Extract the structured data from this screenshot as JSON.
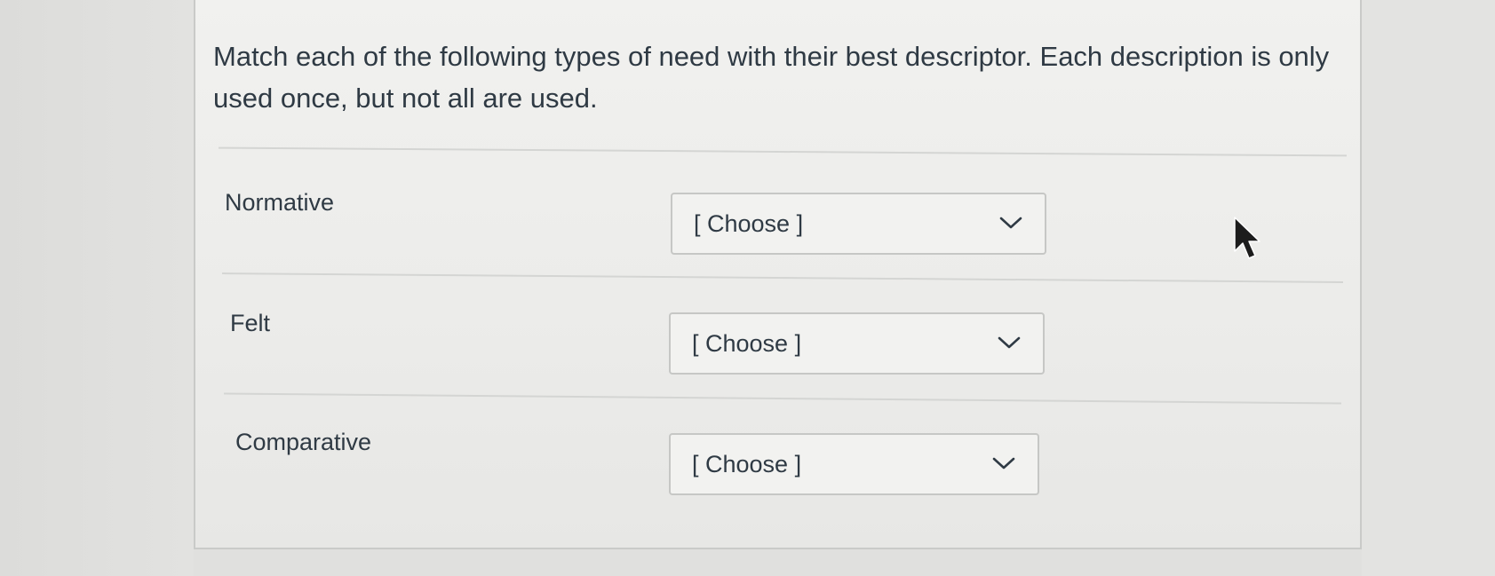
{
  "question": {
    "prompt": "Match each of the following types of need with their best descriptor. Each description is only used once, but not all are used."
  },
  "matches": [
    {
      "label": "Normative",
      "selected": "[ Choose ]"
    },
    {
      "label": "Felt",
      "selected": "[ Choose ]"
    },
    {
      "label": "Comparative",
      "selected": "[ Choose ]"
    }
  ],
  "icons": {
    "dropdown": "chevron-down-icon",
    "pointer": "mouse-cursor-icon"
  }
}
